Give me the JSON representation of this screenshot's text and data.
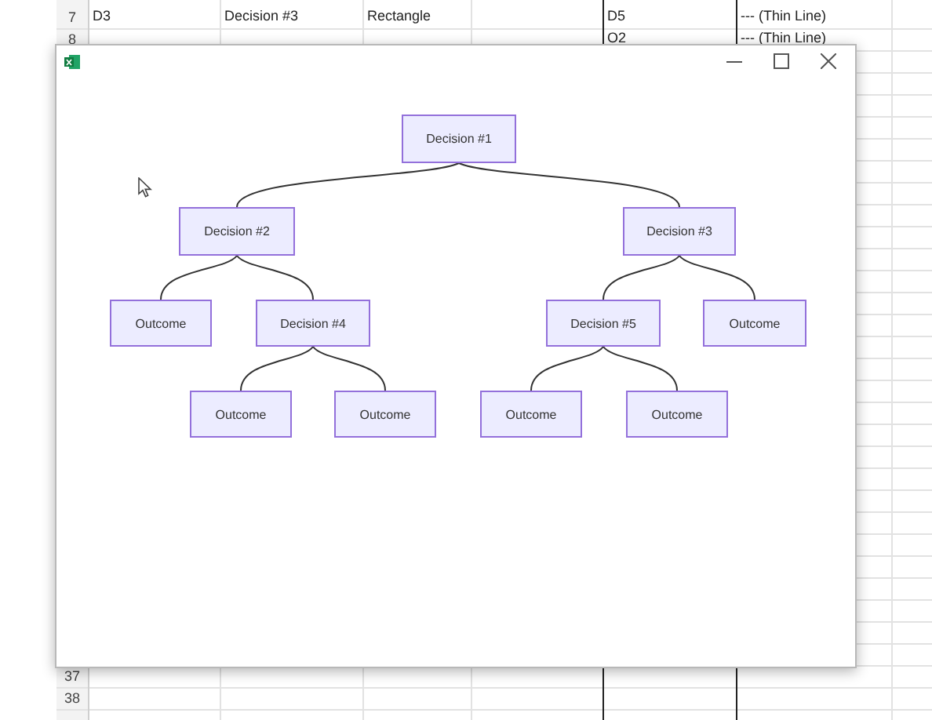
{
  "sheet": {
    "top_rows": [
      {
        "number": "7",
        "cells": [
          "D3",
          "Decision #3",
          "Rectangle",
          "",
          "D5",
          "--- (Thin Line)",
          ""
        ]
      },
      {
        "number": "8",
        "cells": [
          "",
          "",
          "",
          "",
          "O2",
          "--- (Thin Line)",
          ""
        ]
      }
    ],
    "bottom_rows": [
      {
        "number": "37",
        "cells": [
          "",
          "",
          "",
          "",
          "",
          "",
          ""
        ]
      },
      {
        "number": "38",
        "cells": [
          "",
          "",
          "",
          "",
          "",
          "",
          ""
        ]
      }
    ]
  },
  "window": {
    "controls": [
      {
        "kind": "minimize"
      },
      {
        "kind": "maximize"
      },
      {
        "kind": "close"
      }
    ],
    "diagram": {
      "label": "Decision #1",
      "children": [
        {
          "label": "Decision #2",
          "children": [
            {
              "label": "Outcome"
            },
            {
              "label": "Decision #4",
              "children": [
                {
                  "label": "Outcome"
                },
                {
                  "label": "Outcome"
                }
              ]
            }
          ]
        },
        {
          "label": "Decision #3",
          "children": [
            {
              "label": "Decision #5",
              "children": [
                {
                  "label": "Outcome"
                },
                {
                  "label": "Outcome"
                }
              ]
            },
            {
              "label": "Outcome"
            }
          ]
        }
      ]
    }
  }
}
